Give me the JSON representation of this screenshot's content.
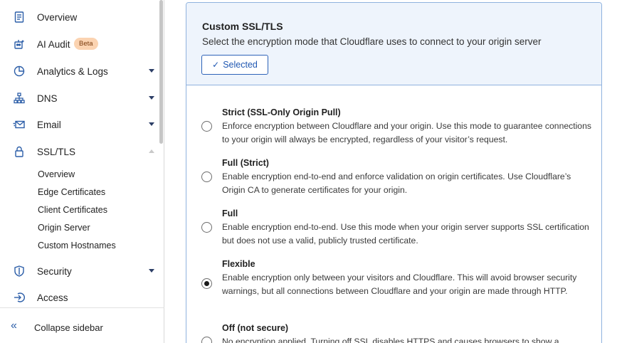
{
  "sidebar": {
    "items": [
      {
        "label": "Overview",
        "icon": "document-icon"
      },
      {
        "label": "AI Audit",
        "icon": "robot-icon",
        "badge": "Beta"
      },
      {
        "label": "Analytics & Logs",
        "icon": "pie-chart-icon"
      },
      {
        "label": "DNS",
        "icon": "network-icon"
      },
      {
        "label": "Email",
        "icon": "envelope-icon"
      },
      {
        "label": "SSL/TLS",
        "icon": "lock-icon"
      },
      {
        "label": "Security",
        "icon": "shield-icon"
      },
      {
        "label": "Access",
        "icon": "login-icon"
      }
    ],
    "ssl_sub_items": [
      "Overview",
      "Edge Certificates",
      "Client Certificates",
      "Origin Server",
      "Custom Hostnames"
    ],
    "collapse_label": "Collapse sidebar",
    "collapse_icon": "«"
  },
  "main": {
    "title": "Custom SSL/TLS",
    "subtitle": "Select the encryption mode that Cloudflare uses to connect to your origin server",
    "selected_label": "Selected",
    "options": [
      {
        "title": "Strict (SSL-Only Origin Pull)",
        "description": "Enforce encryption between Cloudflare and your origin. Use this mode to guarantee connections to your origin will always be encrypted, regardless of your visitor’s request.",
        "checked": false
      },
      {
        "title": "Full (Strict)",
        "description": "Enable encryption end-to-end and enforce validation on origin certificates. Use Cloudflare’s Origin CA to generate certificates for your origin.",
        "checked": false
      },
      {
        "title": "Full",
        "description": "Enable encryption end-to-end. Use this mode when your origin server supports SSL certification but does not use a valid, publicly trusted certificate.",
        "checked": false
      },
      {
        "title": "Flexible",
        "description": "Enable encryption only between your visitors and Cloudflare. This will avoid browser security warnings, but all connections between Cloudflare and your origin are made through HTTP.",
        "checked": true
      },
      {
        "title": "Off (not secure)",
        "description": "No encryption applied. Turning off SSL disables HTTPS and causes browsers to show a",
        "checked": false
      }
    ]
  },
  "colors": {
    "accent": "#2e63b8",
    "card_border": "#8fb2de",
    "card_header_bg": "#eef4fc",
    "badge_bg": "#fbd3b1"
  }
}
